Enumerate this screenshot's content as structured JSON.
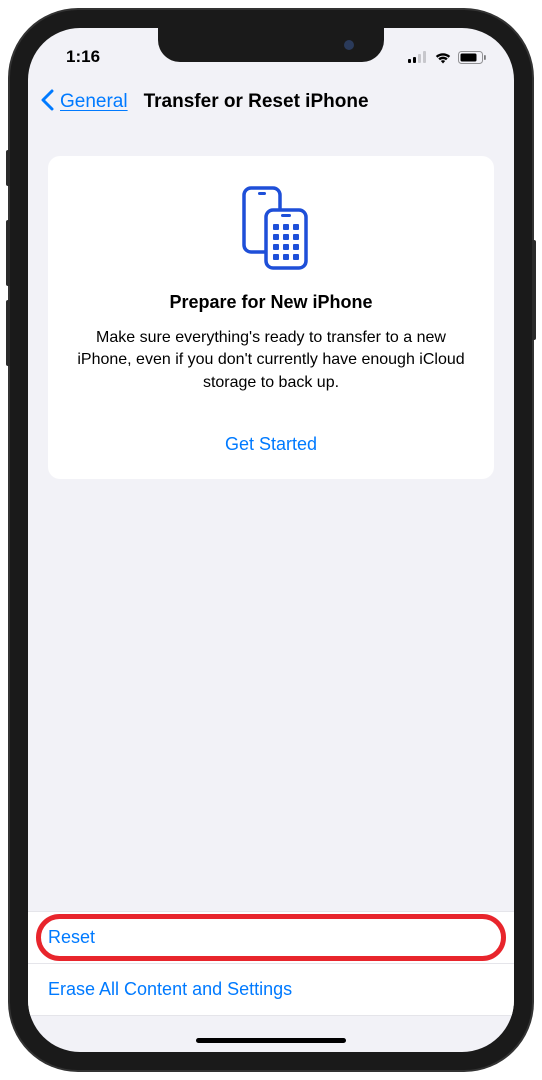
{
  "status": {
    "time": "1:16"
  },
  "nav": {
    "back_label": "General",
    "title": "Transfer or Reset iPhone"
  },
  "card": {
    "title": "Prepare for New iPhone",
    "description": "Make sure everything's ready to transfer to a new iPhone, even if you don't currently have enough iCloud storage to back up.",
    "action_label": "Get Started"
  },
  "options": {
    "reset_label": "Reset",
    "erase_label": "Erase All Content and Settings"
  }
}
